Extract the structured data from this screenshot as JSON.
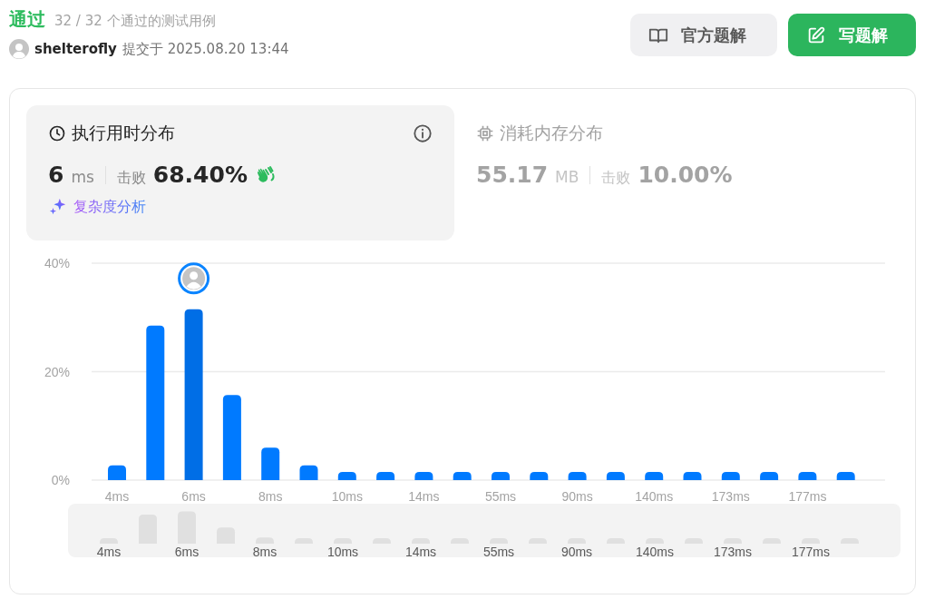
{
  "header": {
    "status": "通过",
    "cases": "32 / 32 个通过的测试用例",
    "user": "shelterofly",
    "submitted": "提交于 2025.08.20 13:44"
  },
  "buttons": [
    {
      "label": "官方题解",
      "kind": "secondary"
    },
    {
      "label": "写题解",
      "kind": "primary"
    }
  ],
  "tabs": [
    {
      "title": "执行用时分布",
      "kind": "time",
      "selected": true,
      "value": "6",
      "unit": "ms",
      "beat_label": "击败",
      "beat": "68.40%",
      "analysis": "复杂度分析"
    },
    {
      "title": "消耗内存分布",
      "kind": "memory",
      "selected": false,
      "value": "55.17",
      "unit": "MB",
      "beat_label": "击败",
      "beat": "10.00%"
    }
  ],
  "chart_data": {
    "type": "bar",
    "stacked": true,
    "categories": [
      "4ms",
      null,
      "6ms",
      null,
      "8ms",
      null,
      "10ms",
      null,
      "14ms",
      null,
      "55ms",
      null,
      "90ms",
      null,
      "140ms",
      null,
      "173ms",
      null,
      "177ms",
      null
    ],
    "series": [
      {
        "color": "#007aff",
        "values": [
          2.7,
          28.5,
          null,
          15.7,
          6.0,
          2.7,
          1.5,
          1.5,
          1.5,
          1.5,
          1.5,
          1.5,
          1.5,
          1.5,
          1.5,
          1.5,
          1.5,
          1.5,
          1.5,
          1.5
        ]
      },
      {
        "color": "#006ee6",
        "values": [
          null,
          null,
          31.5,
          null,
          null,
          null,
          null,
          null,
          null,
          null,
          null,
          null,
          null,
          null,
          null,
          null,
          null,
          null,
          null,
          null
        ]
      }
    ],
    "ylim": [
      0,
      40
    ],
    "yticks": [
      {
        "value": 0,
        "label": "0%"
      },
      {
        "value": 20,
        "label": "20%"
      },
      {
        "value": 40,
        "label": "40%"
      }
    ]
  },
  "overview": {
    "labels": [
      "4ms",
      "6ms",
      "8ms",
      "10ms",
      "14ms",
      "55ms",
      "90ms",
      "140ms",
      "173ms",
      "177ms"
    ]
  }
}
